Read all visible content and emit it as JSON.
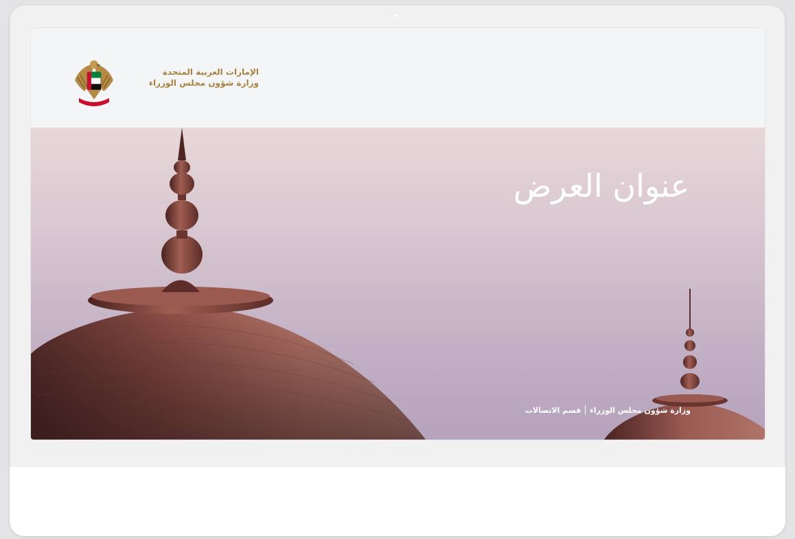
{
  "header": {
    "org_line1": "الإمارات العربية المتحدة",
    "org_line2": "وزارة شؤون مجلس الوزراء",
    "emblem_icon": "uae-emblem-icon"
  },
  "slide": {
    "title": "عنوان العرض",
    "footer_ministry": "وزارة شؤون مجلس الوزراء",
    "footer_department": "قسم الاتصالات"
  },
  "colors": {
    "gold": "#a6823f",
    "dome": "#a0665c"
  }
}
